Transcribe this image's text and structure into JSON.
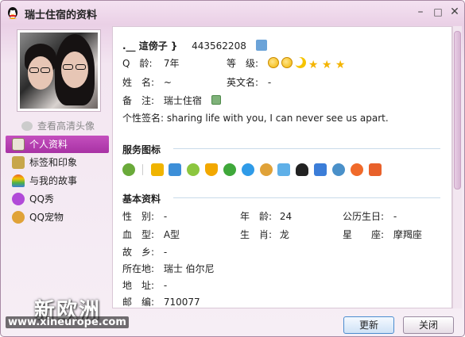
{
  "window": {
    "title": "瑞士住宿的资料",
    "minimize": "–",
    "maximize": "□",
    "close": "✕"
  },
  "left": {
    "hd_link": "查看高清头像",
    "nav": [
      {
        "label": "个人资料",
        "active": true,
        "icon": "profile-card-icon",
        "color": "#e9e4d6"
      },
      {
        "label": "标签和印象",
        "active": false,
        "icon": "tag-icon",
        "color": "#c7a64a"
      },
      {
        "label": "与我的故事",
        "active": false,
        "icon": "rainbow-icon",
        "color": "#e8612b"
      },
      {
        "label": "QQ秀",
        "active": false,
        "icon": "qq-show-icon",
        "color": "#b14ad8"
      },
      {
        "label": "QQ宠物",
        "active": false,
        "icon": "qq-pet-icon",
        "color": "#e0a238"
      }
    ]
  },
  "profile": {
    "nickname": ".__ 這傍子 }",
    "qq_number": "443562208",
    "age_label": "Q　龄:",
    "age_value": "7年",
    "level_label": "等　级:",
    "name_label": "姓　名:",
    "name_value": "~",
    "en_name_label": "英文名:",
    "en_name_value": "-",
    "remark_label": "备　注:",
    "remark_value": "瑞士住宿",
    "signature_label": "个性签名:",
    "signature_value": "sharing life with you, I can never see us apart."
  },
  "service_section": {
    "title": "服务图标",
    "icons": [
      {
        "name": "vip-icon",
        "color": "#6aaa3a"
      },
      {
        "name": "star-service-icon",
        "color": "#f0b400"
      },
      {
        "name": "qzone-icon",
        "color": "#3d8fd8"
      },
      {
        "name": "smile-icon",
        "color": "#8cc63f"
      },
      {
        "name": "shield-icon",
        "color": "#f2a800"
      },
      {
        "name": "clover-icon",
        "color": "#3fa83a"
      },
      {
        "name": "spin-icon",
        "color": "#2f9be8"
      },
      {
        "name": "pet-icon",
        "color": "#e0a238"
      },
      {
        "name": "house-icon",
        "color": "#5fb0e8"
      },
      {
        "name": "penguin-icon",
        "color": "#222222"
      },
      {
        "name": "photo-icon",
        "color": "#3b7dd8"
      },
      {
        "name": "camera-icon",
        "color": "#4a90c9"
      },
      {
        "name": "game-icon",
        "color": "#f06a2a"
      },
      {
        "name": "home-icon",
        "color": "#e8612b"
      }
    ]
  },
  "basic_section": {
    "title": "基本资料",
    "gender_label": "性　别:",
    "gender_value": "-",
    "year_age_label": "年　龄:",
    "year_age_value": "24",
    "birthday_label": "公历生日:",
    "birthday_value": "-",
    "blood_label": "血　型:",
    "blood_value": "A型",
    "zodiac_label": "生　肖:",
    "zodiac_value": "龙",
    "star_label": "星　　座:",
    "star_value": "摩羯座",
    "hometown_label": "故　乡:",
    "hometown_value": "-",
    "location_label": "所在地:",
    "location_value": "瑞士 伯尔尼",
    "address_label": "地　址:",
    "address_value": "-",
    "zip_label": "邮　编:",
    "zip_value": "710077"
  },
  "buttons": {
    "refresh": "更新",
    "close": "关闭"
  },
  "watermark": {
    "brand": "新欧洲",
    "url": "www.xineurope.com"
  },
  "colors": {
    "accent": "#b43aae",
    "title_bg": "#ead0e6"
  }
}
